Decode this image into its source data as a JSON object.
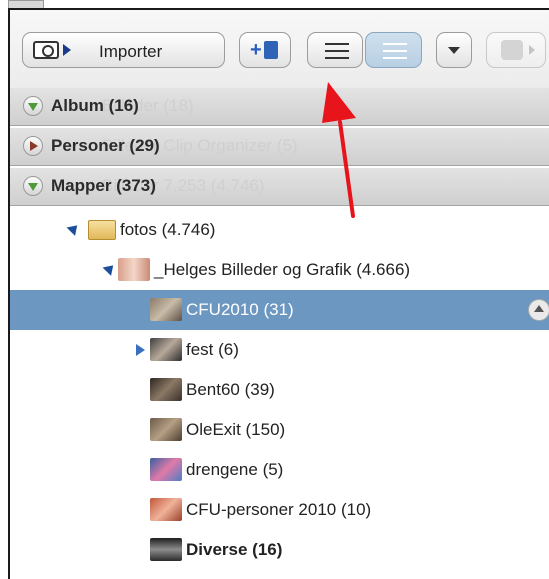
{
  "toolbar": {
    "import_label": "Importer"
  },
  "sections": [
    {
      "label": "Album (16)",
      "ghost": "Billeder (18)",
      "state": "expanded"
    },
    {
      "label": "Personer (29)",
      "ghost": "Billeder Clip Organizer (5)",
      "state": "collapsed"
    },
    {
      "label": "Mapper (373)",
      "ghost": "Billeder 7.253 (4.746)",
      "state": "expanded"
    }
  ],
  "tree": {
    "folder": "fotos (4.746)",
    "subfolder": "_Helges Billeder og Grafik (4.666)",
    "items": [
      {
        "label": "CFU2010 (31)",
        "selected": true
      },
      {
        "label": "fest (6)"
      },
      {
        "label": "Bent60 (39)"
      },
      {
        "label": "OleExit (150)"
      },
      {
        "label": "drengene (5)"
      },
      {
        "label": "CFU-personer 2010 (10)"
      },
      {
        "label": "Diverse (16)",
        "bold": true
      }
    ]
  },
  "colors": {
    "selection": "#6b97c1",
    "annotation_arrow": "#e8141b"
  },
  "icons": [
    "camera-icon",
    "new-album-icon",
    "list-view-icon",
    "grouped-list-view-icon",
    "chevron-down-icon",
    "share-icon",
    "folder-icon",
    "eject-icon"
  ]
}
